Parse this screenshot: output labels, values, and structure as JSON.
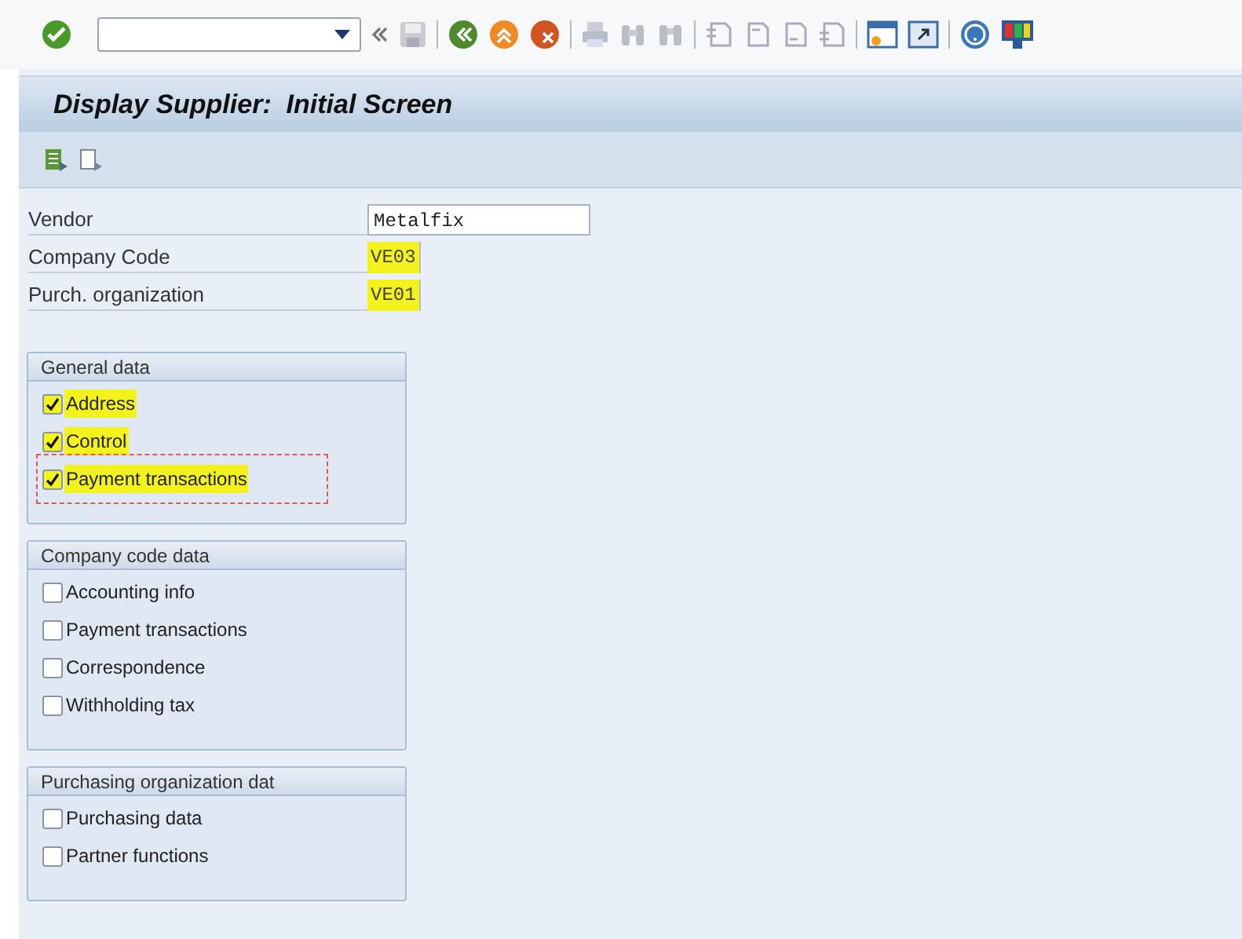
{
  "title": "Display Supplier:  Initial Screen",
  "fields": [
    {
      "label": "Vendor",
      "value": "Metalfix",
      "highlighted": false
    },
    {
      "label": "Company Code",
      "value": "VE03",
      "highlighted": true
    },
    {
      "label": "Purch. organization",
      "value": "VE01",
      "highlighted": true
    }
  ],
  "groups": [
    {
      "title": "General data",
      "options": [
        {
          "label": "Address",
          "checked": true,
          "highlighted": true,
          "focused": false
        },
        {
          "label": "Control",
          "checked": true,
          "highlighted": true,
          "focused": false
        },
        {
          "label": "Payment transactions",
          "checked": true,
          "highlighted": true,
          "focused": true
        }
      ]
    },
    {
      "title": "Company code data",
      "options": [
        {
          "label": "Accounting info",
          "checked": false,
          "highlighted": false,
          "focused": false
        },
        {
          "label": "Payment transactions",
          "checked": false,
          "highlighted": false,
          "focused": false
        },
        {
          "label": "Correspondence",
          "checked": false,
          "highlighted": false,
          "focused": false
        },
        {
          "label": "Withholding tax",
          "checked": false,
          "highlighted": false,
          "focused": false
        }
      ]
    },
    {
      "title": "Purchasing organization dat",
      "options": [
        {
          "label": "Purchasing data",
          "checked": false,
          "highlighted": false,
          "focused": false
        },
        {
          "label": "Partner functions",
          "checked": false,
          "highlighted": false,
          "focused": false
        }
      ]
    }
  ]
}
